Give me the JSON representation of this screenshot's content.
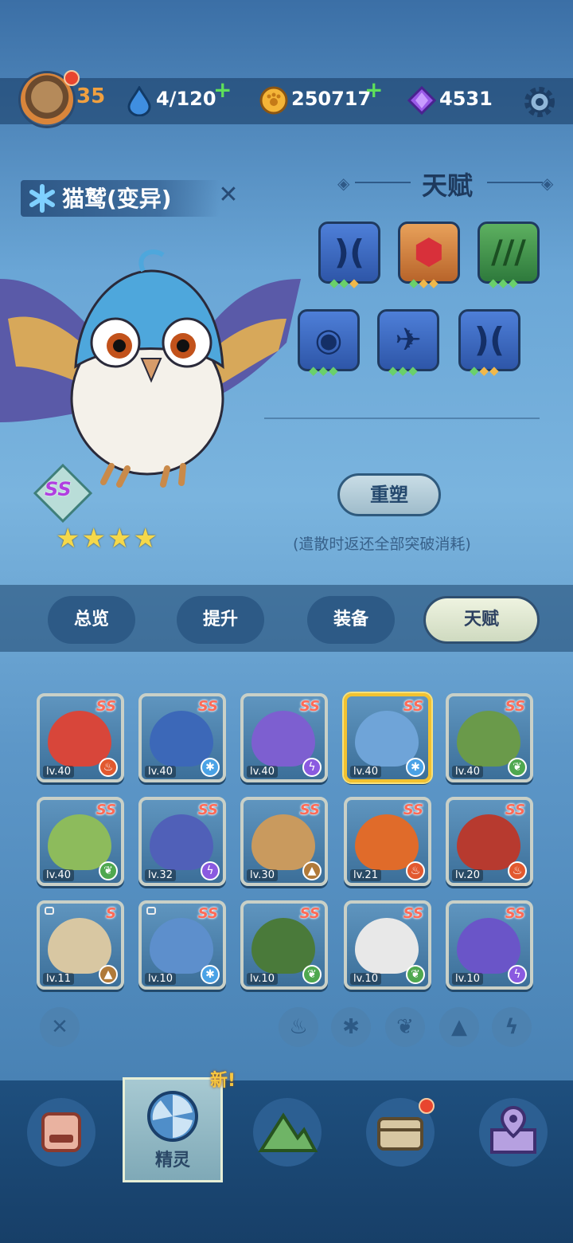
{
  "header": {
    "level": "35",
    "stamina": "4/120",
    "coins": "250717",
    "gems": "4531"
  },
  "pet": {
    "name": "猫鹫(变异)",
    "rank": "SS",
    "stars": 4
  },
  "talent": {
    "title": "天赋",
    "reshape_label": "重塑",
    "hint": "(遣散时返还全部突破消耗)"
  },
  "tabs": [
    "总览",
    "提升",
    "装备",
    "天赋"
  ],
  "active_tab": "天赋",
  "pets": [
    {
      "rank": "SS",
      "level": "lv.40",
      "element": "fire",
      "color": "#d8463a"
    },
    {
      "rank": "SS",
      "level": "lv.40",
      "element": "ice",
      "color": "#3c68b8"
    },
    {
      "rank": "SS",
      "level": "lv.40",
      "element": "thunder",
      "color": "#7d5fd0"
    },
    {
      "rank": "SS",
      "level": "lv.40",
      "element": "ice",
      "color": "#6fa4d8",
      "selected": true
    },
    {
      "rank": "SS",
      "level": "lv.40",
      "element": "wood",
      "color": "#6a9a4a"
    },
    {
      "rank": "SS",
      "level": "lv.40",
      "element": "wood",
      "color": "#8dbb5c"
    },
    {
      "rank": "SS",
      "level": "lv.32",
      "element": "thunder",
      "color": "#5060b8"
    },
    {
      "rank": "SS",
      "level": "lv.30",
      "element": "earth",
      "color": "#c99a5e"
    },
    {
      "rank": "SS",
      "level": "lv.21",
      "element": "fire",
      "color": "#e06b2a"
    },
    {
      "rank": "SS",
      "level": "lv.20",
      "element": "fire",
      "color": "#b73a2f"
    },
    {
      "rank": "S",
      "level": "lv.11",
      "element": "earth",
      "color": "#d8c7a2",
      "locked": true
    },
    {
      "rank": "SS",
      "level": "lv.10",
      "element": "ice",
      "color": "#5d8fcc",
      "locked": true
    },
    {
      "rank": "SS",
      "level": "lv.10",
      "element": "wood",
      "color": "#4a7a3a"
    },
    {
      "rank": "SS",
      "level": "lv.10",
      "element": "wood",
      "color": "#e8e8e8"
    },
    {
      "rank": "SS",
      "level": "lv.10",
      "element": "thunder",
      "color": "#6a55c8"
    }
  ],
  "nav": {
    "active_label": "精灵",
    "new_tag": "新!"
  }
}
